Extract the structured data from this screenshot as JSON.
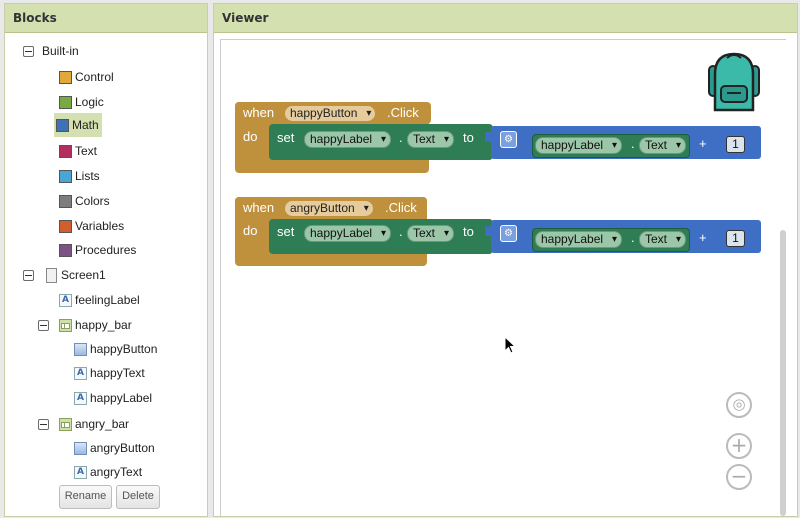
{
  "blocks_panel": {
    "title": "Blocks",
    "builtin_label": "Built-in",
    "categories": [
      {
        "label": "Control",
        "color": "#e1a93a"
      },
      {
        "label": "Logic",
        "color": "#77ab41"
      },
      {
        "label": "Math",
        "color": "#3f71b5"
      },
      {
        "label": "Text",
        "color": "#b32d5e"
      },
      {
        "label": "Lists",
        "color": "#49a6d4"
      },
      {
        "label": "Colors",
        "color": "#7d7d7d"
      },
      {
        "label": "Variables",
        "color": "#d05f2d"
      },
      {
        "label": "Procedures",
        "color": "#7c5385"
      }
    ],
    "screen_label": "Screen1",
    "components": {
      "feeling_label": "feelingLabel",
      "happy_bar": "happy_bar",
      "happy_button": "happyButton",
      "happy_text": "happyText",
      "happy_label": "happyLabel",
      "angry_bar": "angry_bar",
      "angry_button": "angryButton",
      "angry_text": "angryText"
    },
    "rename_label": "Rename",
    "delete_label": "Delete"
  },
  "viewer": {
    "title": "Viewer",
    "blocks": [
      {
        "when": "when",
        "component": "happyButton",
        "event": ".Click",
        "do": "do",
        "set": "set",
        "target": "happyLabel",
        "dot": ".",
        "prop": "Text",
        "to": "to",
        "get_component": "happyLabel",
        "get_prop": "Text",
        "op": "+",
        "number": "1"
      },
      {
        "when": "when",
        "component": "angryButton",
        "event": ".Click",
        "do": "do",
        "set": "set",
        "target": "happyLabel",
        "dot": ".",
        "prop": "Text",
        "to": "to",
        "get_component": "happyLabel",
        "get_prop": "Text",
        "op": "+",
        "number": "1"
      }
    ],
    "controls": {
      "center": "◎",
      "zoom_in": "+",
      "zoom_out": "−"
    }
  }
}
